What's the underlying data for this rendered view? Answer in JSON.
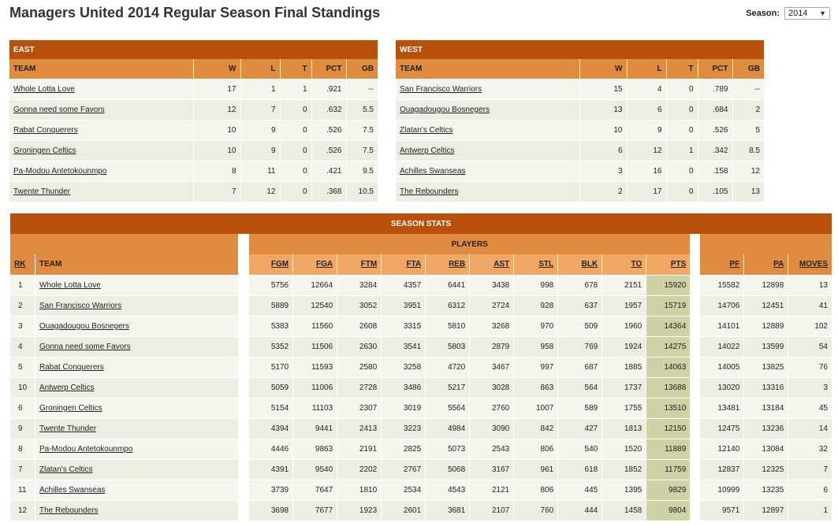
{
  "page": {
    "title": "Managers United 2014 Regular Season Final Standings"
  },
  "season": {
    "label": "Season:",
    "value": "2014"
  },
  "east": {
    "heading": "EAST",
    "columns": [
      "TEAM",
      "W",
      "L",
      "T",
      "PCT",
      "GB"
    ],
    "rows": [
      [
        "Whole Lotta Love",
        "17",
        "1",
        "1",
        ".921",
        "--"
      ],
      [
        "Gonna need some Favors",
        "12",
        "7",
        "0",
        ".632",
        "5.5"
      ],
      [
        "Rabat Conquerers",
        "10",
        "9",
        "0",
        ".526",
        "7.5"
      ],
      [
        "Groningen Celtics",
        "10",
        "9",
        "0",
        ".526",
        "7.5"
      ],
      [
        "Pa-Modou Antetokounmpo",
        "8",
        "11",
        "0",
        ".421",
        "9.5"
      ],
      [
        "Twente Thunder",
        "7",
        "12",
        "0",
        ".368",
        "10.5"
      ]
    ]
  },
  "west": {
    "heading": "WEST",
    "columns": [
      "TEAM",
      "W",
      "L",
      "T",
      "PCT",
      "GB"
    ],
    "rows": [
      [
        "San Francisco Warriors",
        "15",
        "4",
        "0",
        ".789",
        "--"
      ],
      [
        "Ouagadougou Bosnegers",
        "13",
        "6",
        "0",
        ".684",
        "2"
      ],
      [
        "Zlatan's Celtics",
        "10",
        "9",
        "0",
        ".526",
        "5"
      ],
      [
        "Antwerp Celtics",
        "6",
        "12",
        "1",
        ".342",
        "8.5"
      ],
      [
        "Achilles Swanseas",
        "3",
        "16",
        "0",
        ".158",
        "12"
      ],
      [
        "The Rebounders",
        "2",
        "17",
        "0",
        ".105",
        "13"
      ]
    ]
  },
  "stats": {
    "heading": "SEASON STATS",
    "players_heading": "PLAYERS",
    "columns": [
      "RK",
      "TEAM",
      "FGM",
      "FGA",
      "FTM",
      "FTA",
      "REB",
      "AST",
      "STL",
      "BLK",
      "TO",
      "PTS",
      "PF",
      "PA",
      "MOVES"
    ],
    "rows": [
      [
        "1",
        "Whole Lotta Love",
        "5756",
        "12664",
        "3284",
        "4357",
        "6441",
        "3438",
        "998",
        "678",
        "2151",
        "15920",
        "15582",
        "12898",
        "13"
      ],
      [
        "2",
        "San Francisco Warriors",
        "5889",
        "12540",
        "3052",
        "3951",
        "6312",
        "2724",
        "928",
        "637",
        "1957",
        "15719",
        "14706",
        "12451",
        "41"
      ],
      [
        "3",
        "Ouagadougou Bosnegers",
        "5383",
        "11560",
        "2608",
        "3315",
        "5810",
        "3268",
        "970",
        "509",
        "1960",
        "14364",
        "14101",
        "12889",
        "102"
      ],
      [
        "4",
        "Gonna need some Favors",
        "5352",
        "11506",
        "2630",
        "3541",
        "5803",
        "2879",
        "958",
        "769",
        "1924",
        "14275",
        "14022",
        "13599",
        "54"
      ],
      [
        "5",
        "Rabat Conquerers",
        "5170",
        "11593",
        "2580",
        "3258",
        "4720",
        "3467",
        "997",
        "687",
        "1885",
        "14063",
        "14005",
        "13825",
        "76"
      ],
      [
        "10",
        "Antwerp Celtics",
        "5059",
        "11006",
        "2728",
        "3486",
        "5217",
        "3028",
        "863",
        "564",
        "1737",
        "13688",
        "13020",
        "13316",
        "3"
      ],
      [
        "6",
        "Groningen Celtics",
        "5154",
        "11103",
        "2307",
        "3019",
        "5564",
        "2760",
        "1007",
        "589",
        "1755",
        "13510",
        "13481",
        "13184",
        "45"
      ],
      [
        "9",
        "Twente Thunder",
        "4394",
        "9441",
        "2413",
        "3223",
        "4984",
        "3090",
        "842",
        "427",
        "1813",
        "12150",
        "12475",
        "13236",
        "14"
      ],
      [
        "8",
        "Pa-Modou Antetokounmpo",
        "4446",
        "9863",
        "2191",
        "2825",
        "5073",
        "2543",
        "806",
        "540",
        "1520",
        "11889",
        "12140",
        "13084",
        "32"
      ],
      [
        "7",
        "Zlatan's Celtics",
        "4391",
        "9540",
        "2202",
        "2767",
        "5068",
        "3167",
        "961",
        "618",
        "1852",
        "11759",
        "12837",
        "12325",
        "7"
      ],
      [
        "11",
        "Achilles Swanseas",
        "3739",
        "7647",
        "1810",
        "2534",
        "4543",
        "2121",
        "806",
        "445",
        "1395",
        "9829",
        "10999",
        "13235",
        "6"
      ],
      [
        "12",
        "The Rebounders",
        "3698",
        "7677",
        "1923",
        "2601",
        "3681",
        "2107",
        "760",
        "444",
        "1458",
        "9804",
        "9571",
        "12897",
        "1"
      ]
    ]
  }
}
